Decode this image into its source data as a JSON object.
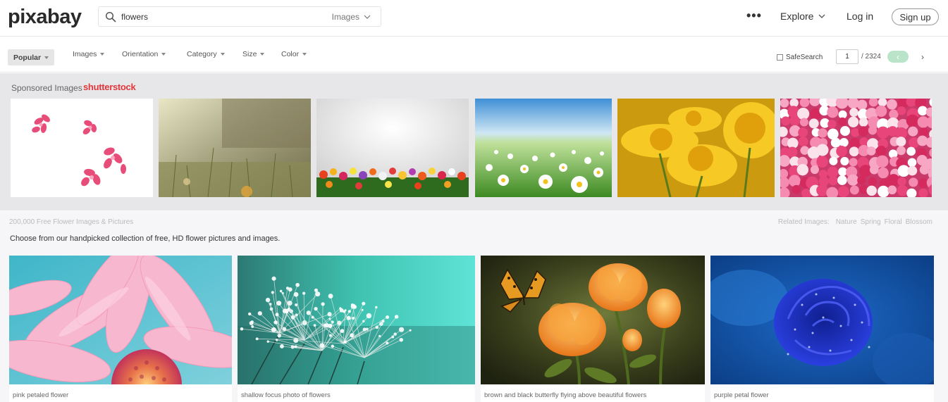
{
  "header": {
    "logo": "pixabay",
    "search_value": "flowers",
    "search_type": "Images",
    "more": "•••",
    "explore": "Explore",
    "login": "Log in",
    "signup": "Sign up"
  },
  "filters": {
    "items": [
      "Popular",
      "Images",
      "Orientation",
      "Category",
      "Size",
      "Color"
    ],
    "safesearch": "SafeSearch",
    "page_current": "1",
    "page_total": "/ 2324",
    "prev": "‹",
    "next": "›"
  },
  "sponsored": {
    "label": "Sponsored Images",
    "brand": "shutterstock"
  },
  "results": {
    "count": "200,000 Free Flower Images & Pictures",
    "related_label": "Related Images:",
    "related": [
      "Nature",
      "Spring",
      "Floral",
      "Blossom"
    ],
    "description": "Choose from our handpicked collection of free, HD flower pictures and images.",
    "cards": [
      {
        "caption": "pink petaled flower"
      },
      {
        "caption": "shallow focus photo of flowers"
      },
      {
        "caption": "brown and black butterfly flying above beautiful flowers"
      },
      {
        "caption": "purple petal flower"
      }
    ]
  },
  "colors": {
    "brand_red": "#e2363b",
    "accent_green": "#b9e4c9",
    "sponsored_bg": "#e7e7e9",
    "main_bg": "#f6f6f8"
  }
}
